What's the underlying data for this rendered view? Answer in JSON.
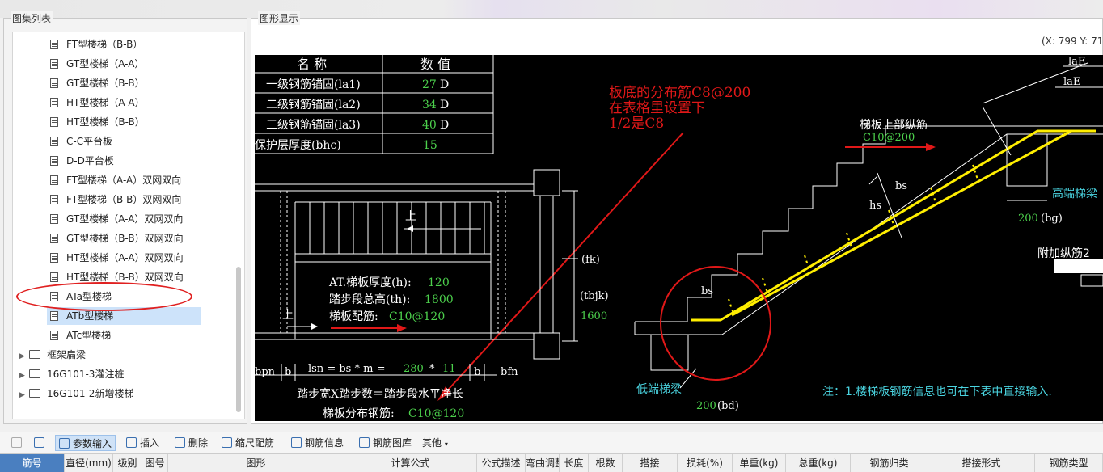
{
  "left_panel": {
    "title": "图集列表",
    "items": [
      {
        "label": "FT型楼梯（B-B）",
        "type": "file"
      },
      {
        "label": "GT型楼梯（A-A）",
        "type": "file"
      },
      {
        "label": "GT型楼梯（B-B）",
        "type": "file"
      },
      {
        "label": "HT型楼梯（A-A）",
        "type": "file"
      },
      {
        "label": "HT型楼梯（B-B）",
        "type": "file"
      },
      {
        "label": "C-C平台板",
        "type": "file"
      },
      {
        "label": "D-D平台板",
        "type": "file"
      },
      {
        "label": "FT型楼梯（A-A）双网双向",
        "type": "file"
      },
      {
        "label": "FT型楼梯（B-B）双网双向",
        "type": "file"
      },
      {
        "label": "GT型楼梯（A-A）双网双向",
        "type": "file"
      },
      {
        "label": "GT型楼梯（B-B）双网双向",
        "type": "file"
      },
      {
        "label": "HT型楼梯（A-A）双网双向",
        "type": "file"
      },
      {
        "label": "HT型楼梯（B-B）双网双向",
        "type": "file"
      },
      {
        "label": "ATa型楼梯",
        "type": "file"
      },
      {
        "label": "ATb型楼梯",
        "type": "file",
        "selected": true
      },
      {
        "label": "ATc型楼梯",
        "type": "file"
      },
      {
        "label": "框架扁梁",
        "type": "folder"
      },
      {
        "label": "16G101-3灌注桩",
        "type": "folder"
      },
      {
        "label": "16G101-2新增楼梯",
        "type": "folder"
      }
    ]
  },
  "right_panel": {
    "title": "图形显示",
    "coords": "(X: 799 Y: 717"
  },
  "cad": {
    "table": {
      "headers": [
        "名  称",
        "数  值"
      ],
      "rows": [
        {
          "name": "一级钢筋锚固(la1)",
          "value": "27",
          "unit": "D"
        },
        {
          "name": "二级钢筋锚固(la2)",
          "value": "34",
          "unit": "D"
        },
        {
          "name": "三级钢筋锚固(la3)",
          "value": "40",
          "unit": "D"
        },
        {
          "name": "保护层厚度(bhc)",
          "value": "15",
          "unit": ""
        }
      ]
    },
    "annotation_red": [
      "板底的分布筋C8@200",
      "在表格里设置下",
      "1/2是C8"
    ],
    "plan": {
      "up_label": "上",
      "up_label2": "上",
      "thickness_label": "AT.梯板厚度(h):",
      "thickness_value": "120",
      "height_label": "踏步段总高(th):",
      "height_value": "1800",
      "rebar_label": "梯板配筋:",
      "rebar_value": "C10@120",
      "fk": "(fk)",
      "tbjk": "(tbjk)",
      "tbjk_value": "1600",
      "dim_pn": "bpn",
      "dim_b1": "b",
      "dim_formula": "lsn = bs * m =",
      "dim_280": "280",
      "dim_star": "*",
      "dim_11": "11",
      "dim_b2": "b",
      "dim_bfn": "bfn",
      "step_formula": "踏步宽X踏步数＝踏步段水平净长",
      "dist_label": "梯板分布钢筋:",
      "dist_value": "C10@120"
    },
    "section": {
      "laE1": "laE",
      "laE2": "laE",
      "top_rebar_label": "梯板上部纵筋",
      "top_rebar_value": "C10@200",
      "bs1": "bs",
      "hs": "hs",
      "bs2": "bs",
      "high_beam": "高端梯梁",
      "bg_value": "200",
      "bg": "(bg)",
      "add_rebar": "附加纵筋2",
      "low_beam": "低端梯梁",
      "bd_value": "200",
      "bd": "(bd)",
      "note": "注：1.楼梯板钢筋信息也可在下表中直接输入."
    }
  },
  "toolbar": {
    "items": [
      "参数输入",
      "插入",
      "删除",
      "缩尺配筋",
      "钢筋信息",
      "钢筋图库",
      "其他"
    ]
  },
  "grid": {
    "headers": [
      "筋号",
      "直径(mm)",
      "级别",
      "图号",
      "图形",
      "计算公式",
      "公式描述",
      "弯曲调整",
      "长度",
      "根数",
      "搭接",
      "损耗(%)",
      "单重(kg)",
      "总重(kg)",
      "钢筋归类",
      "搭接形式",
      "钢筋类型"
    ]
  }
}
